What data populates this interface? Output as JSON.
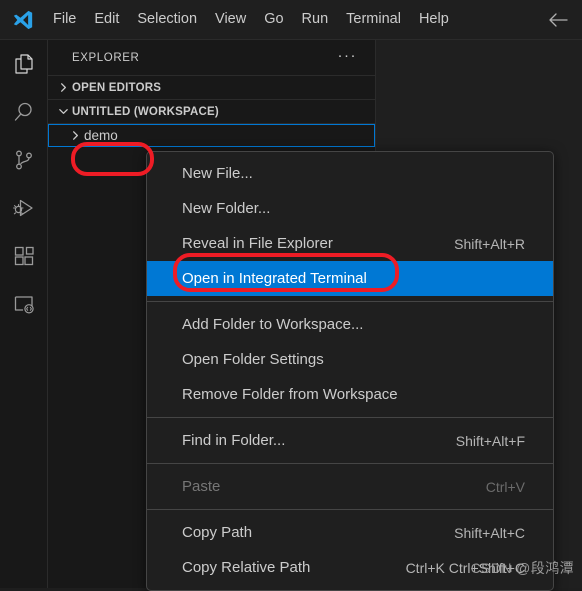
{
  "window": {
    "back_arrow_icon": "arrow-left-icon",
    "logo_icon": "vscode-logo-icon"
  },
  "menubar": {
    "items": [
      {
        "label": "File"
      },
      {
        "label": "Edit"
      },
      {
        "label": "Selection"
      },
      {
        "label": "View"
      },
      {
        "label": "Go"
      },
      {
        "label": "Run"
      },
      {
        "label": "Terminal"
      },
      {
        "label": "Help"
      }
    ]
  },
  "activitybar": {
    "items": [
      {
        "icon": "files-explorer-icon",
        "active": true
      },
      {
        "icon": "search-icon",
        "active": false
      },
      {
        "icon": "source-control-icon",
        "active": false
      },
      {
        "icon": "run-and-debug-icon",
        "active": false
      },
      {
        "icon": "extensions-icon",
        "active": false
      },
      {
        "icon": "remote-explorer-icon",
        "active": false
      }
    ]
  },
  "sidebar": {
    "title": "EXPLORER",
    "more_actions": "···",
    "sections": [
      {
        "label": "OPEN EDITORS",
        "expanded": false,
        "chevron": "chevron-right-icon"
      },
      {
        "label": "UNTITLED (WORKSPACE)",
        "expanded": true,
        "chevron": "chevron-down-icon"
      }
    ],
    "tree": [
      {
        "label": "demo",
        "expanded": false,
        "chevron": "chevron-right-icon",
        "selected": true
      }
    ]
  },
  "context_menu": {
    "items": [
      {
        "label": "New File...",
        "keybinding": "",
        "state": "normal",
        "separator_after": false
      },
      {
        "label": "New Folder...",
        "keybinding": "",
        "state": "normal",
        "separator_after": false
      },
      {
        "label": "Reveal in File Explorer",
        "keybinding": "Shift+Alt+R",
        "state": "normal",
        "separator_after": false
      },
      {
        "label": "Open in Integrated Terminal",
        "keybinding": "",
        "state": "highlighted",
        "separator_after": true
      },
      {
        "label": "Add Folder to Workspace...",
        "keybinding": "",
        "state": "normal",
        "separator_after": false
      },
      {
        "label": "Open Folder Settings",
        "keybinding": "",
        "state": "normal",
        "separator_after": false
      },
      {
        "label": "Remove Folder from Workspace",
        "keybinding": "",
        "state": "normal",
        "separator_after": true
      },
      {
        "label": "Find in Folder...",
        "keybinding": "Shift+Alt+F",
        "state": "normal",
        "separator_after": true
      },
      {
        "label": "Paste",
        "keybinding": "Ctrl+V",
        "state": "disabled",
        "separator_after": true
      },
      {
        "label": "Copy Path",
        "keybinding": "Shift+Alt+C",
        "state": "normal",
        "separator_after": false
      },
      {
        "label": "Copy Relative Path",
        "keybinding": "Ctrl+K Ctrl+Shift+C",
        "state": "normal",
        "separator_after": false
      }
    ]
  },
  "annotations": {
    "color": "#ee1c25",
    "targets": [
      "demo",
      "Open in Integrated Terminal"
    ]
  },
  "watermark": {
    "text": "CSDN @段鸿潭"
  },
  "colors": {
    "accent": "#0078d4",
    "titlebar_bg": "#1f1f1f",
    "activitybar_bg": "#181818",
    "sidebar_bg": "#181818",
    "editor_bg": "#1f1f1f",
    "menu_bg": "#1f1f1f",
    "text": "#cccccc",
    "annotation_red": "#ee1c25"
  }
}
